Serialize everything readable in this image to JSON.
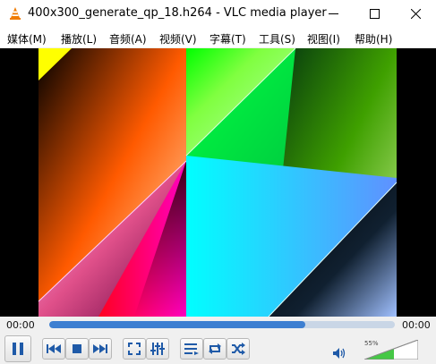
{
  "window": {
    "title": "400x300_generate_qp_18.h264 - VLC media player",
    "minimize_icon": "minimize-icon",
    "maximize_icon": "maximize-icon",
    "close_icon": "close-icon"
  },
  "menu": {
    "items": [
      "媒体(M)",
      "播放(L)",
      "音频(A)",
      "视频(V)",
      "字幕(T)",
      "工具(S)",
      "视图(I)",
      "帮助(H)"
    ]
  },
  "playback": {
    "elapsed": "00:00",
    "remaining": "00:00",
    "progress_fraction": 0.74
  },
  "volume": {
    "label": "55%",
    "level_fraction": 0.55,
    "icon": "speaker-icon"
  },
  "colors": {
    "seek_fill": "#3d7fd1",
    "seek_track": "#c9d6e6",
    "volume_fill": "#46c846",
    "vlc_orange": "#f07c00"
  }
}
